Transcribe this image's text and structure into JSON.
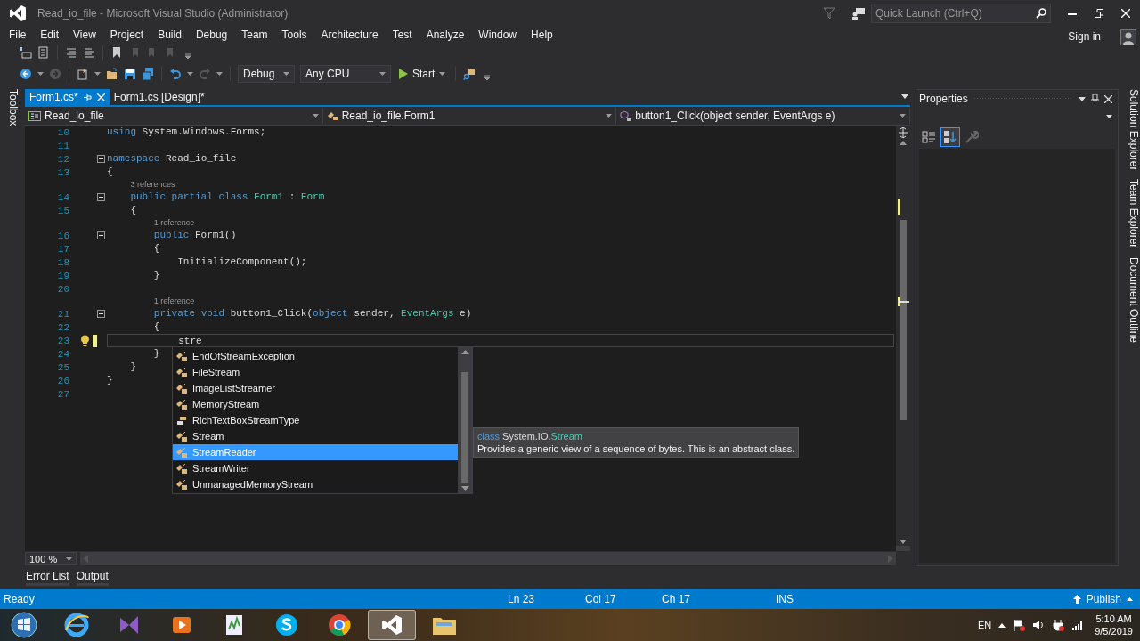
{
  "window": {
    "title": "Read_io_file - Microsoft Visual Studio (Administrator)"
  },
  "quick_launch": {
    "placeholder": "Quick Launch (Ctrl+Q)"
  },
  "menu": [
    "File",
    "Edit",
    "View",
    "Project",
    "Build",
    "Debug",
    "Team",
    "Tools",
    "Architecture",
    "Test",
    "Analyze",
    "Window",
    "Help"
  ],
  "sign_in": "Sign in",
  "toolbar": {
    "configuration": "Debug",
    "platform": "Any CPU",
    "start": "Start"
  },
  "toolbox_tab": "Toolbox",
  "editor": {
    "tabs": [
      {
        "label": "Form1.cs*",
        "selected": true
      },
      {
        "label": "Form1.cs [Design]*",
        "selected": false
      }
    ],
    "nav": [
      {
        "kind": "project",
        "label": "Read_io_file"
      },
      {
        "kind": "class",
        "label": "Read_io_file.Form1"
      },
      {
        "kind": "method",
        "label": "button1_Click(object sender, EventArgs e)"
      }
    ],
    "lines": [
      {
        "kind": "code",
        "number": "10",
        "foldable": false,
        "current": false,
        "tokens": [
          {
            "text": "using",
            "kind": "keyword"
          },
          {
            "text": " System.Windows.Forms;",
            "kind": "plain"
          }
        ]
      },
      {
        "kind": "code",
        "number": "11",
        "foldable": false,
        "current": false
      },
      {
        "kind": "code",
        "number": "12",
        "foldable": true,
        "current": false,
        "tokens": [
          {
            "text": "namespace",
            "kind": "keyword"
          },
          {
            "text": " Read_io_file",
            "kind": "plain"
          }
        ]
      },
      {
        "kind": "code",
        "number": "13",
        "foldable": false,
        "current": false,
        "tokens": [
          {
            "text": "{",
            "kind": "plain"
          }
        ]
      },
      {
        "kind": "lens",
        "text": "3 references"
      },
      {
        "kind": "code",
        "number": "14",
        "foldable": true,
        "current": false,
        "tokens": [
          {
            "text": "    public",
            "kind": "keyword"
          },
          {
            "text": " partial",
            "kind": "keyword"
          },
          {
            "text": " class",
            "kind": "keyword"
          },
          {
            "text": " Form1",
            "kind": "type"
          },
          {
            "text": " :",
            "kind": "plain"
          },
          {
            "text": " Form",
            "kind": "type"
          }
        ]
      },
      {
        "kind": "code",
        "number": "15",
        "foldable": false,
        "current": false,
        "tokens": [
          {
            "text": "    {",
            "kind": "plain"
          }
        ]
      },
      {
        "kind": "lens",
        "text": "1 reference"
      },
      {
        "kind": "code",
        "number": "16",
        "foldable": true,
        "current": false,
        "tokens": [
          {
            "text": "        public",
            "kind": "keyword"
          },
          {
            "text": " Form1()",
            "kind": "plain"
          }
        ]
      },
      {
        "kind": "code",
        "number": "17",
        "foldable": false,
        "current": false,
        "tokens": [
          {
            "text": "        {",
            "kind": "plain"
          }
        ]
      },
      {
        "kind": "code",
        "number": "18",
        "foldable": false,
        "current": false,
        "tokens": [
          {
            "text": "            InitializeComponent();",
            "kind": "plain"
          }
        ]
      },
      {
        "kind": "code",
        "number": "19",
        "foldable": false,
        "current": false,
        "tokens": [
          {
            "text": "        }",
            "kind": "plain"
          }
        ]
      },
      {
        "kind": "code",
        "number": "20",
        "foldable": false,
        "current": false
      },
      {
        "kind": "lens",
        "text": "1 reference"
      },
      {
        "kind": "code",
        "number": "21",
        "foldable": true,
        "current": false,
        "tokens": [
          {
            "text": "        private",
            "kind": "keyword"
          },
          {
            "text": " void",
            "kind": "keyword"
          },
          {
            "text": " button1_Click(",
            "kind": "plain"
          },
          {
            "text": "object",
            "kind": "keyword"
          },
          {
            "text": " sender,",
            "kind": "plain"
          },
          {
            "text": " EventArgs",
            "kind": "type"
          },
          {
            "text": " e)",
            "kind": "plain"
          }
        ]
      },
      {
        "kind": "code",
        "number": "22",
        "foldable": false,
        "current": false,
        "tokens": [
          {
            "text": "        {",
            "kind": "plain"
          }
        ]
      },
      {
        "kind": "code",
        "number": "23",
        "foldable": false,
        "current": true,
        "tokens": [
          {
            "text": "            stre",
            "kind": "plain"
          }
        ]
      },
      {
        "kind": "code",
        "number": "24",
        "foldable": false,
        "current": false,
        "tokens": [
          {
            "text": "        }",
            "kind": "plain"
          }
        ]
      },
      {
        "kind": "code",
        "number": "25",
        "foldable": false,
        "current": false,
        "tokens": [
          {
            "text": "    }",
            "kind": "plain"
          }
        ]
      },
      {
        "kind": "code",
        "number": "26",
        "foldable": false,
        "current": false,
        "tokens": [
          {
            "text": "}",
            "kind": "plain"
          }
        ]
      },
      {
        "kind": "code",
        "number": "27",
        "foldable": false,
        "current": false
      }
    ],
    "completion": [
      {
        "kind": "class",
        "label": "EndOfStreamException",
        "selected": false
      },
      {
        "kind": "class",
        "label": "FileStream",
        "selected": false
      },
      {
        "kind": "class",
        "label": "ImageListStreamer",
        "selected": false
      },
      {
        "kind": "class",
        "label": "MemoryStream",
        "selected": false
      },
      {
        "kind": "enum",
        "label": "RichTextBoxStreamType",
        "selected": false
      },
      {
        "kind": "class",
        "label": "Stream",
        "selected": false
      },
      {
        "kind": "class",
        "label": "StreamReader",
        "selected": true
      },
      {
        "kind": "class",
        "label": "StreamWriter",
        "selected": false
      },
      {
        "kind": "class",
        "label": "UnmanagedMemoryStream",
        "selected": false
      }
    ],
    "tooltip": {
      "signature": [
        {
          "text": "class",
          "kind": "keyword"
        },
        {
          "text": " System.IO.",
          "kind": "plain"
        },
        {
          "text": "Stream",
          "kind": "type"
        }
      ],
      "description": "Provides a generic view of a sequence of bytes. This is an abstract class."
    },
    "zoom": "100 %"
  },
  "properties": {
    "title": "Properties"
  },
  "side_tabs": [
    "Solution Explorer",
    "Team Explorer",
    "Document Outline"
  ],
  "bottom_tabs": [
    "Error List",
    "Output"
  ],
  "status_bar": {
    "message": "Ready",
    "line": "Ln 23",
    "column": "Col 17",
    "char": "Ch 17",
    "mode": "INS",
    "publish": "Publish"
  },
  "taskbar": {
    "items": [
      {
        "kind": "start",
        "active": false
      },
      {
        "kind": "browser",
        "active": false
      },
      {
        "kind": "ribbon",
        "active": false
      },
      {
        "kind": "media",
        "active": false
      },
      {
        "kind": "notepad",
        "active": false
      },
      {
        "kind": "chat",
        "active": false
      },
      {
        "kind": "chrome",
        "active": false
      },
      {
        "kind": "ide",
        "active": true
      },
      {
        "kind": "folder",
        "active": false
      }
    ],
    "language": "EN",
    "time": "5:10 AM",
    "date": "9/5/2019"
  }
}
